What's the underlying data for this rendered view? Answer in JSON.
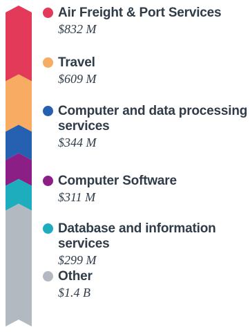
{
  "chart_data": {
    "type": "bar",
    "orientation": "vertical-stacked",
    "legend_position": "right",
    "categories": [
      "Air Freight & Port Services",
      "Travel",
      "Computer and data processing services",
      "Computer Software",
      "Database and information services",
      "Other"
    ],
    "values": [
      832,
      609,
      344,
      311,
      299,
      1400
    ],
    "value_labels": [
      "$832 M",
      "$609 M",
      "$344 M",
      "$311 M",
      "$299 M",
      "$1.4 B"
    ],
    "unit": "$ millions",
    "colors": [
      "#e33a5a",
      "#f8ac63",
      "#2561b0",
      "#8c1f86",
      "#1dadbd",
      "#b3b9c0"
    ]
  }
}
